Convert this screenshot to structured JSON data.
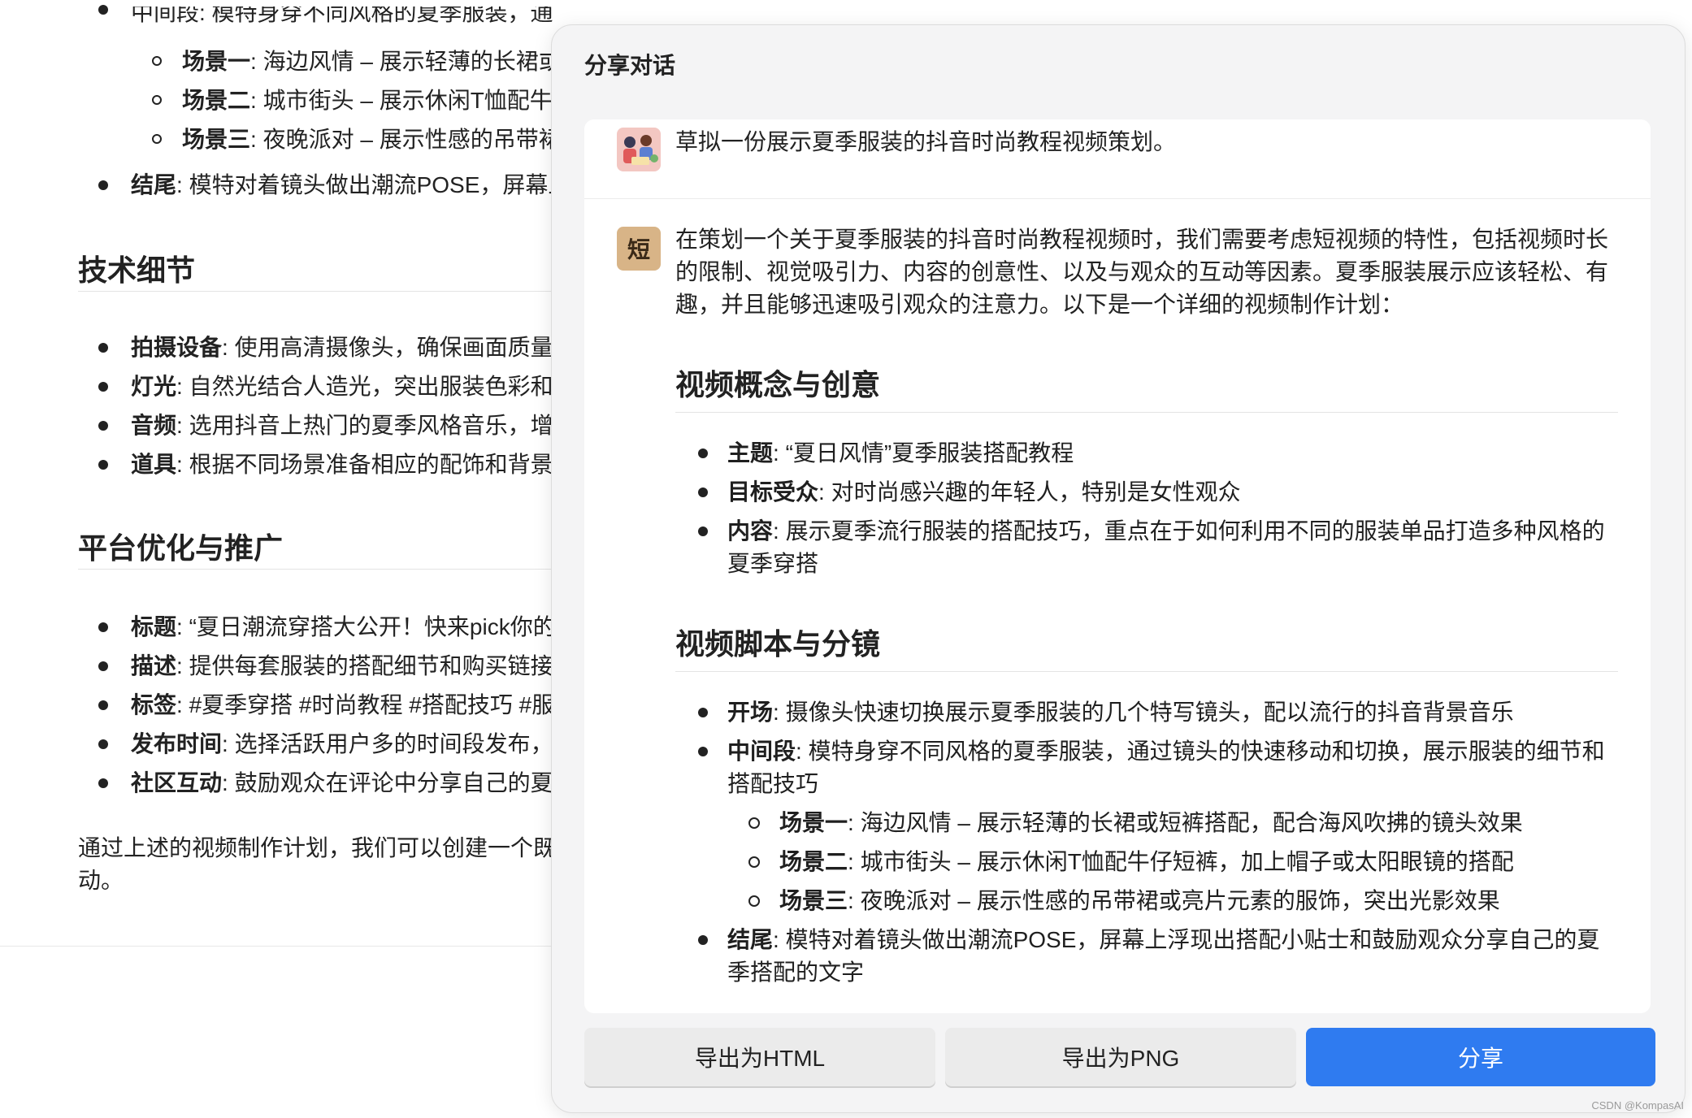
{
  "background": {
    "top_fragment": "中间段: 模特身穿不同风格的夏季服装，通",
    "scene_items": [
      {
        "key": "场景一",
        "text": ": 海边风情 – 展示轻薄的长裙或"
      },
      {
        "key": "场景二",
        "text": ": 城市街头 – 展示休闲T恤配牛"
      },
      {
        "key": "场景三",
        "text": ": 夜晚派对 – 展示性感的吊带裙"
      }
    ],
    "ending": {
      "key": "结尾",
      "text": ": 模特对着镜头做出潮流POSE，屏幕上"
    },
    "tech_heading": "技术细节",
    "tech_items": [
      {
        "key": "拍摄设备",
        "text": ": 使用高清摄像头，确保画面质量"
      },
      {
        "key": "灯光",
        "text": ": 自然光结合人造光，突出服装色彩和"
      },
      {
        "key": "音频",
        "text": ": 选用抖音上热门的夏季风格音乐，增"
      },
      {
        "key": "道具",
        "text": ": 根据不同场景准备相应的配饰和背景"
      }
    ],
    "platform_heading": "平台优化与推广",
    "platform_items": [
      {
        "key": "标题",
        "text": ": “夏日潮流穿搭大公开！快来pick你的"
      },
      {
        "key": "描述",
        "text": ": 提供每套服装的搭配细节和购买链接"
      },
      {
        "key": "标签",
        "text": ": #夏季穿搭 #时尚教程 #搭配技巧 #服"
      },
      {
        "key": "发布时间",
        "text": ": 选择活跃用户多的时间段发布，"
      },
      {
        "key": "社区互动",
        "text": ": 鼓励观众在评论中分享自己的夏"
      }
    ],
    "conclusion": "通过上述的视频制作计划，我们可以创建一个既",
    "conclusion_line2": "动。"
  },
  "toolbar": {
    "icons": [
      "scissors-icon",
      "folder-icon",
      "notion-icon",
      "microphone-icon"
    ]
  },
  "dialog": {
    "title": "分享对话",
    "user_message": "草拟一份展示夏季服装的抖音时尚教程视频策划。",
    "bot_avatar_char": "短",
    "intro": "在策划一个关于夏季服装的抖音时尚教程视频时，我们需要考虑短视频的特性，包括视频时长的限制、视觉吸引力、内容的创意性、以及与观众的互动等因素。夏季服装展示应该轻松、有趣，并且能够迅速吸引观众的注意力。以下是一个详细的视频制作计划：",
    "section1_heading": "视频概念与创意",
    "section1_items": [
      {
        "key": "主题",
        "text": ": “夏日风情”夏季服装搭配教程"
      },
      {
        "key": "目标受众",
        "text": ": 对时尚感兴趣的年轻人，特别是女性观众"
      },
      {
        "key": "内容",
        "text": ": 展示夏季流行服装的搭配技巧，重点在于如何利用不同的服装单品打造多种风格的夏季穿搭"
      }
    ],
    "section2_heading": "视频脚本与分镜",
    "section2_items": [
      {
        "key": "开场",
        "text": ": 摄像头快速切换展示夏季服装的几个特写镜头，配以流行的抖音背景音乐"
      },
      {
        "key": "中间段",
        "text": ": 模特身穿不同风格的夏季服装，通过镜头的快速移动和切换，展示服装的细节和搭配技巧"
      }
    ],
    "section2_sub_items": [
      {
        "key": "场景一",
        "text": ": 海边风情 – 展示轻薄的长裙或短裤搭配，配合海风吹拂的镜头效果"
      },
      {
        "key": "场景二",
        "text": ": 城市街头 – 展示休闲T恤配牛仔短裤，加上帽子或太阳眼镜的搭配"
      },
      {
        "key": "场景三",
        "text": ": 夜晚派对 – 展示性感的吊带裙或亮片元素的服饰，突出光影效果"
      }
    ],
    "section2_last": {
      "key": "结尾",
      "text": ": 模特对着镜头做出潮流POSE，屏幕上浮现出搭配小贴士和鼓励观众分享自己的夏季搭配的文字"
    },
    "buttons": {
      "export_html": "导出为HTML",
      "export_png": "导出为PNG",
      "share": "分享"
    },
    "colors": {
      "share_button": "#2f7bf0",
      "bot_avatar": "#d8b487"
    }
  },
  "watermark": "CSDN @KompasAI"
}
